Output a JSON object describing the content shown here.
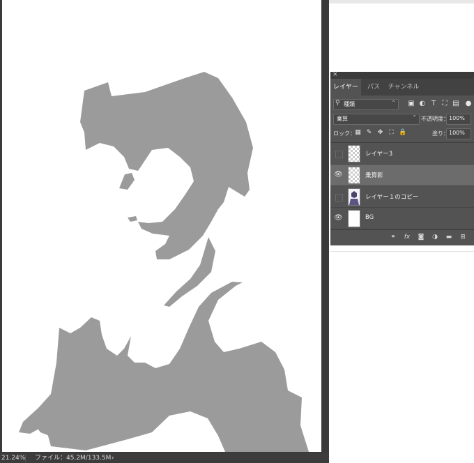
{
  "status": {
    "zoom": "21.24%",
    "file_info": "ファイル：45.2M/133.5M",
    "arrow": "›"
  },
  "panel": {
    "close": "×",
    "tabs": [
      {
        "label": "レイヤー"
      },
      {
        "label": "パス"
      },
      {
        "label": "チャンネル"
      }
    ],
    "filter": {
      "icon": "search-icon",
      "label": "種類",
      "chevron": "⌃"
    },
    "blend_mode": {
      "value": "乗算",
      "chevron": "⌃"
    },
    "opacity": {
      "label": "不透明度：",
      "value": "100%"
    },
    "lock": {
      "label": "ロック："
    },
    "fill": {
      "label": "塗り：",
      "value": "100%"
    },
    "layers": [
      {
        "name": "レイヤー3",
        "visible": false
      },
      {
        "name": "乗算影",
        "visible": true,
        "selected": true
      },
      {
        "name": "レイヤー１のコピー",
        "visible": false
      },
      {
        "name": "BG",
        "visible": true
      }
    ]
  },
  "colors": {
    "silhouette": "#9b9b9b",
    "panel_bg": "#535353",
    "selected_layer": "#6c6c6c"
  }
}
